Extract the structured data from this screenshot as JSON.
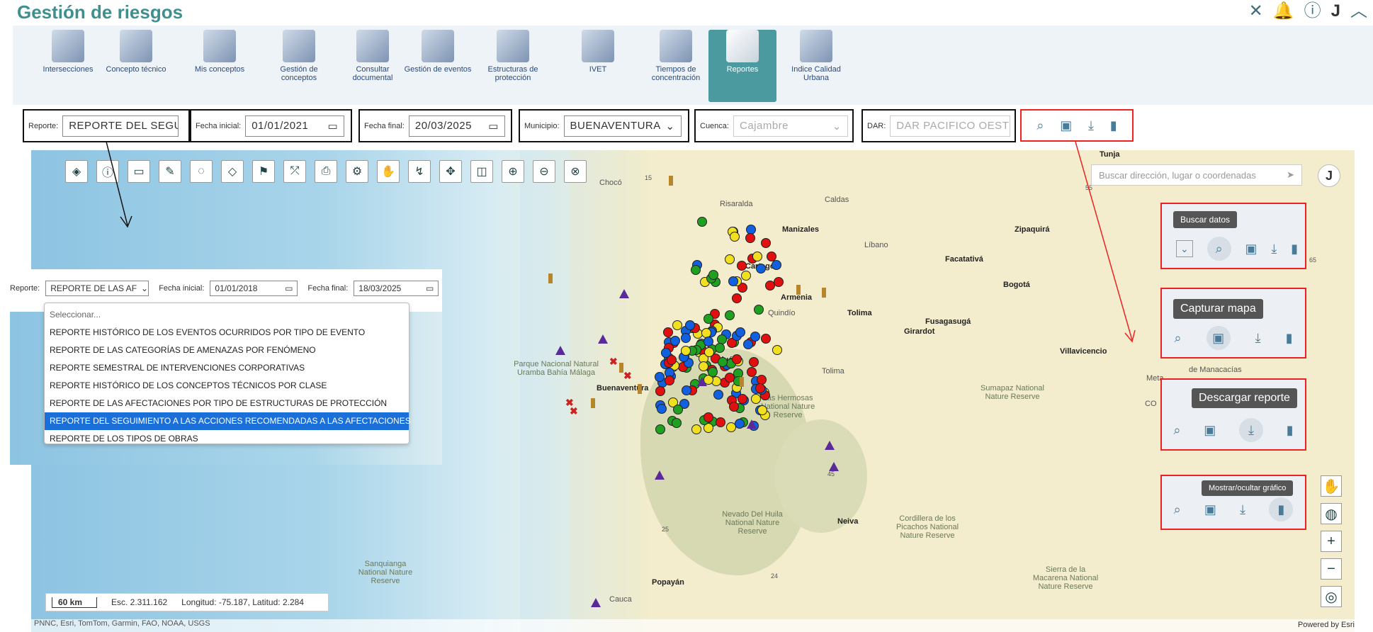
{
  "app": {
    "title": "Gestión de riesgos",
    "user_initial": "J"
  },
  "header_icons": [
    "map-settings-icon",
    "bell-icon",
    "help-icon",
    "user",
    "collapse"
  ],
  "modules": [
    {
      "label": "Intersecciones",
      "active": false
    },
    {
      "label": "Concepto técnico",
      "active": false
    },
    {
      "label": "Mis conceptos",
      "active": false
    },
    {
      "label": "Gestión de conceptos",
      "active": false
    },
    {
      "label": "Consultar documental",
      "active": false
    },
    {
      "label": "Gestión de eventos",
      "active": false
    },
    {
      "label": "Estructuras de protección",
      "active": false
    },
    {
      "label": "IVET",
      "active": false
    },
    {
      "label": "Tiempos de concentración",
      "active": false
    },
    {
      "label": "Reportes",
      "active": true
    },
    {
      "label": "Indice Calidad Urbana",
      "active": false
    }
  ],
  "filters": {
    "reporte": {
      "label": "Reporte:",
      "value": "REPORTE DEL SEGU"
    },
    "fecha_inicial": {
      "label": "Fecha inicial:",
      "value": "01/01/2021"
    },
    "fecha_final": {
      "label": "Fecha final:",
      "value": "20/03/2025"
    },
    "municipio": {
      "label": "Municipio:",
      "value": "BUENAVENTURA"
    },
    "cuenca": {
      "label": "Cuenca:",
      "placeholder": "Cajambre"
    },
    "dar": {
      "label": "DAR:",
      "placeholder": "DAR PACIFICO OEST"
    }
  },
  "search": {
    "placeholder": "Buscar dirección, lugar o coordenadas"
  },
  "callouts": {
    "buscar": "Buscar datos",
    "capturar": "Capturar mapa",
    "descargar": "Descargar reporte",
    "mostrar": "Mostrar/ocultar gráfico"
  },
  "inset": {
    "reporte_label": "Reporte:",
    "reporte_value": "REPORTE DE LAS AF",
    "fi_label": "Fecha inicial:",
    "fi_value": "01/01/2018",
    "ff_label": "Fecha final:",
    "ff_value": "18/03/2025",
    "options": [
      "Seleccionar...",
      "REPORTE HISTÓRICO DE LOS EVENTOS OCURRIDOS POR TIPO DE EVENTO",
      "REPORTE DE LAS CATEGORÍAS DE AMENAZAS POR FENÓMENO",
      "REPORTE SEMESTRAL DE INTERVENCIONES CORPORATIVAS",
      "REPORTE HISTÓRICO DE LOS CONCEPTOS TÉCNICOS POR CLASE",
      "REPORTE DE LAS AFECTACIONES POR TIPO DE ESTRUCTURAS DE PROTECCIÓN",
      "REPORTE DEL SEGUIMIENTO A LAS ACCIONES RECOMENDADAS A LAS AFECTACIONES",
      "REPORTE DE LOS TIPOS DE OBRAS"
    ],
    "selected_index": 6
  },
  "scale": {
    "bar": "60 km",
    "esc": "Esc. 2.311.162",
    "coords": "Longitud: -75.187, Latitud: 2.284"
  },
  "attribution": "PNNC, Esri, TomTom, Garmin, FAO, NOAA, USGS",
  "powered": "Powered by Esri",
  "map_labels": {
    "tunja": "Tunja",
    "zipaquira": "Zipaquirá",
    "facatativa": "Facatativá",
    "bogota": "Bogotá",
    "fusagasuga": "Fusagasugá",
    "villavicencio": "Villavicencio",
    "manizales": "Manizales",
    "libano": "Líbano",
    "caldas": "Caldas",
    "risaralda": "Risaralda",
    "cartago": "Cartago",
    "armenia": "Armenia",
    "quindio": "Quindío",
    "tolima": "Tolima",
    "tolima2": "Tolima",
    "girardot": "Girardot",
    "tulua": "Tuluá",
    "buenaventura": "Buenaventura",
    "neiva": "Neiva",
    "popayan": "Popayán",
    "cauca": "Cauca",
    "meta": "Meta",
    "choco": "Chocó",
    "manacacias": "de Manacacías",
    "co": "CO",
    "uramba": "Parque Nacional Natural Uramba Bahía Málaga",
    "hermosas": "Las Hermosas National Nature Reserve",
    "huila": "Nevado Del Huila National Nature Reserve",
    "picachos": "Cordillera de los Picachos National Nature Reserve",
    "sumapaz": "Sumapaz National Nature Reserve",
    "sanquianga": "Sanquianga National Nature Reserve",
    "macarena": "Sierra de la Macarena National Nature Reserve",
    "r15": "15",
    "r55": "55",
    "r45": "45",
    "r25": "25",
    "r24": "24",
    "r65": "65"
  },
  "colors": {
    "accent": "#3f8f8f",
    "active_module": "#4b9aa0",
    "callout_border": "#ee2222",
    "selected_option": "#1a6fd8"
  }
}
